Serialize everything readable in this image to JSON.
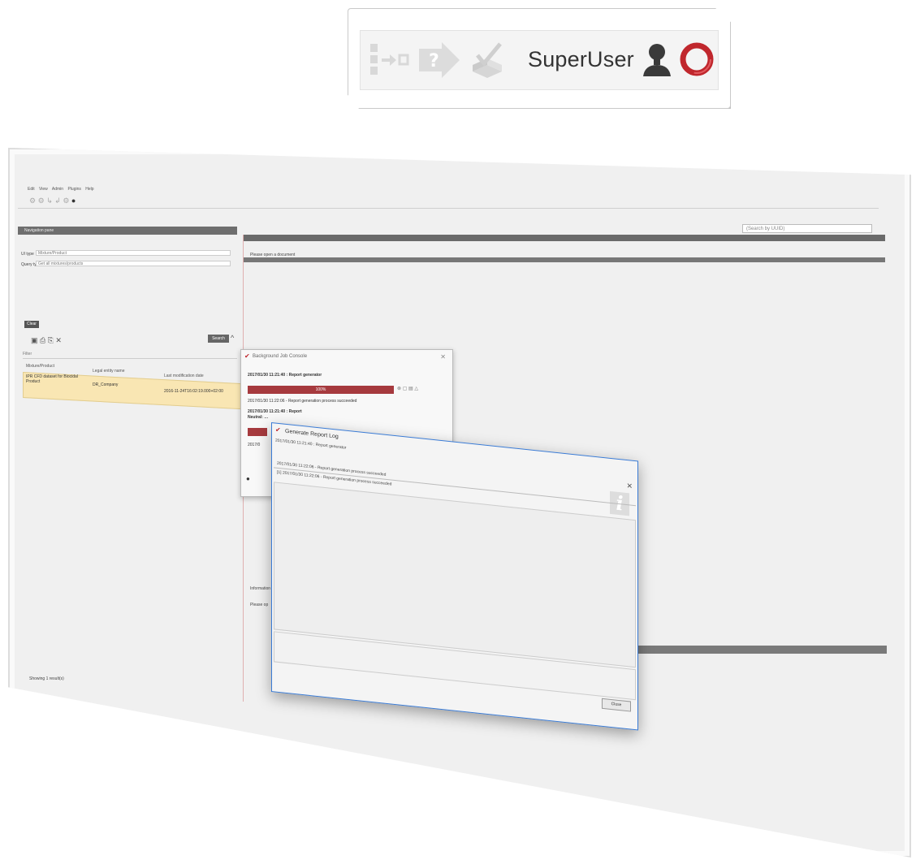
{
  "callout": {
    "user_label": "SuperUser",
    "icons": [
      "layout-switch-icon",
      "help-arrow-icon",
      "validate-stamp-icon",
      "user-silhouette-icon",
      "logout-ring-icon"
    ]
  },
  "menu": {
    "items": [
      "Edit",
      "View",
      "Admin",
      "Plugins",
      "Help"
    ]
  },
  "toolbar": {
    "search_uuid_placeholder": "(Search by UUID)"
  },
  "nav": {
    "title": "Navigation pane",
    "field1_label": "UI type",
    "field1_value": "Mixture/Product",
    "field2_label": "Query type",
    "field2_value": "Get all mixtures/products",
    "clear_label": "Clear",
    "search_label": "Search",
    "filter_placeholder": "Filter",
    "columns": [
      "Mixture/Product",
      "Legal entity name",
      "Last modification date"
    ],
    "row": {
      "name": "IPR CFD dataset for Biocidal Product",
      "entity": "DR_Company",
      "date": "2016-11-24T16:02:19.000+02:00"
    },
    "results": "Showing 1 result(s)"
  },
  "document": {
    "message": "Please open a document",
    "info_label": "Information",
    "info_msg": "Please op"
  },
  "bjc": {
    "title": "Background Job Console",
    "job1_title": "2017/01/30 11:21:40 : Report generator",
    "job1_progress": 100,
    "job1_progress_label": "100%",
    "job1_msg": "2017/01/30 11:22:06 - Report generation process succeeded",
    "job2_title": "2017/01/30 11:21:40 : Report",
    "job2_sub": "Neutral: …",
    "job2_msg": "2017/0"
  },
  "grl": {
    "title": "Generate Report Log",
    "subtitle": "2017/01/30 11:21:40 : Report generator",
    "line1": "2017/01/30 11:22:06 - Report generation process succeeded",
    "line2": "[1] 2017/01/30 11:22:06 - Report generation process succeeded",
    "close_label": "Close"
  },
  "colors": {
    "progress": "#a63a3e",
    "selected_row": "#f9e6b3",
    "pane_header": "#6e6e6e"
  }
}
